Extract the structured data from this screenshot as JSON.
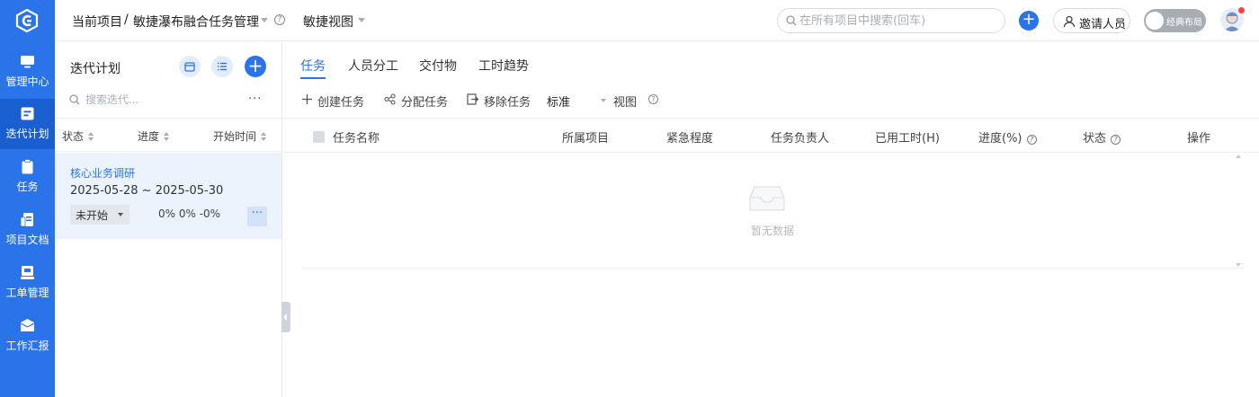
{
  "brand": {
    "logo_icon": "logo-icon",
    "accent": "#2a73e8"
  },
  "nav": {
    "items": [
      {
        "label": "管理中心",
        "icon": "monitor-icon"
      },
      {
        "label": "迭代计划",
        "icon": "iteration-icon",
        "active": true
      },
      {
        "label": "任务",
        "icon": "clipboard-icon"
      },
      {
        "label": "项目文档",
        "icon": "document-icon"
      },
      {
        "label": "工单管理",
        "icon": "ticket-icon"
      },
      {
        "label": "工作汇报",
        "icon": "report-icon"
      }
    ]
  },
  "header": {
    "current_project": "当前项目",
    "separator": "/",
    "project_name": "敏捷瀑布融合任务管理",
    "help": "?",
    "view_name": "敏捷视图",
    "search_placeholder": "在所有项目中搜索(回车)",
    "add": "+",
    "invite": "邀请人员",
    "layout_toggle": "经典布局"
  },
  "iteration": {
    "title": "迭代计划",
    "search_placeholder": "搜索迭代...",
    "more": "···",
    "add": "+",
    "columns": [
      "状态",
      "进度",
      "开始时间"
    ],
    "items": [
      {
        "name": "核心业务调研",
        "dates": "2025-05-28 ~ 2025-05-30",
        "status": "未开始",
        "progress": "0%  0%  -0%",
        "more": "···"
      }
    ]
  },
  "main": {
    "tabs": [
      "任务",
      "人员分工",
      "交付物",
      "工时趋势"
    ],
    "active_tab": "任务",
    "toolbar": {
      "create": "创建任务",
      "assign": "分配任务",
      "remove": "移除任务",
      "standard": "标准",
      "view": "视图",
      "help": "?"
    },
    "table": {
      "columns": [
        "任务名称",
        "所属项目",
        "紧急程度",
        "任务负责人",
        "已用工时(H)",
        "进度(%)",
        "状态",
        "操作"
      ],
      "help": "?",
      "empty_text": "暂无数据"
    }
  }
}
